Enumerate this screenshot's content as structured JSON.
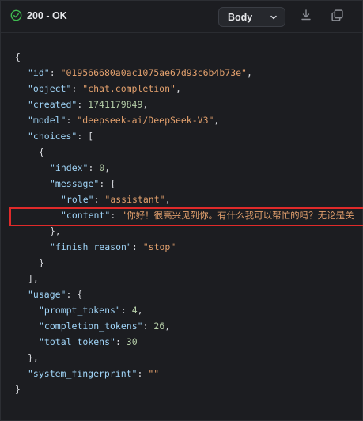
{
  "header": {
    "status_text": "200 - OK",
    "status_color": "#3fb950",
    "view_select": "Body",
    "icons": [
      "check-circle-icon",
      "chevron-down-icon",
      "download-icon",
      "copy-icon"
    ]
  },
  "code": {
    "l01": "{",
    "l02": {
      "key": "\"id\"",
      "value": "\"019566680a0ac1075ae67d93c6b4b73e\""
    },
    "l03": {
      "key": "\"object\"",
      "value": "\"chat.completion\""
    },
    "l04": {
      "key": "\"created\"",
      "value": "1741179849"
    },
    "l05": {
      "key": "\"model\"",
      "value": "\"deepseek-ai/DeepSeek-V3\""
    },
    "l06": {
      "key": "\"choices\"",
      "punct": "["
    },
    "l07": "{",
    "l08": {
      "key": "\"index\"",
      "value": "0"
    },
    "l09": {
      "key": "\"message\"",
      "punct": "{"
    },
    "l10": {
      "key": "\"role\"",
      "value": "\"assistant\""
    },
    "l11": {
      "key": "\"content\"",
      "value": "\"你好！很高兴见到你。有什么我可以帮忙的吗？无论是关"
    },
    "l12": "},",
    "l13": {
      "key": "\"finish_reason\"",
      "value": "\"stop\""
    },
    "l14": "}",
    "l15": "],",
    "l16": {
      "key": "\"usage\"",
      "punct": "{"
    },
    "l17": {
      "key": "\"prompt_tokens\"",
      "value": "4"
    },
    "l18": {
      "key": "\"completion_tokens\"",
      "value": "26"
    },
    "l19": {
      "key": "\"total_tokens\"",
      "value": "30"
    },
    "l20": "},",
    "l21": {
      "key": "\"system_fingerprint\"",
      "value": "\"\""
    },
    "l22": "}"
  },
  "highlight_color": "#e02a2a"
}
